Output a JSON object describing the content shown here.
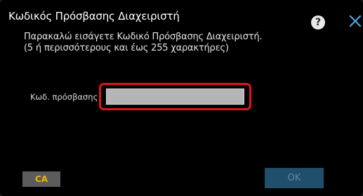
{
  "dialog": {
    "title": "Κωδικός Πρόσβασης Διαχειριστή",
    "help_label": "?",
    "close_icon": "close-icon",
    "help_icon": "help-icon"
  },
  "instructions": {
    "line1": "Παρακαλώ εισάγετε Κωδικό Πρόσβασης Διαχειριστή.",
    "line2": "(5 ή περισσότερους και έως 255 χαρακτήρες)"
  },
  "password": {
    "label": "Κωδ. πρόσβασης",
    "value": "",
    "placeholder": ""
  },
  "buttons": {
    "ca_label": "CA",
    "ok_label": "OK"
  },
  "colors": {
    "focus_border": "#e0141c",
    "ca_text": "#e8b800",
    "ok_bg": "#1f4f6b",
    "close_icon": "#4aa8e0"
  }
}
